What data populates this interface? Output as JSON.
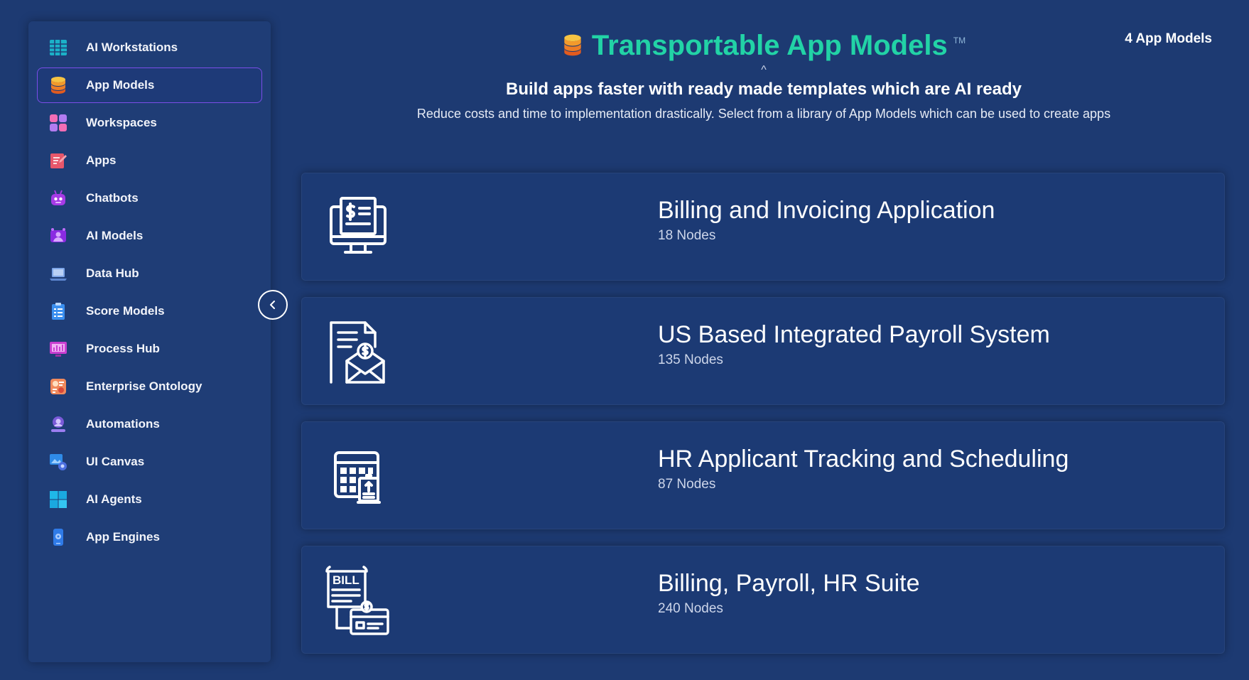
{
  "sidebar": {
    "items": [
      {
        "label": "AI Workstations",
        "icon": "table-grid-icon"
      },
      {
        "label": "App Models",
        "icon": "database-stack-icon",
        "active": true
      },
      {
        "label": "Workspaces",
        "icon": "four-squares-icon"
      },
      {
        "label": "Apps",
        "icon": "notepad-edit-icon"
      },
      {
        "label": "Chatbots",
        "icon": "robot-icon"
      },
      {
        "label": "AI Models",
        "icon": "ai-model-icon"
      },
      {
        "label": "Data Hub",
        "icon": "laptop-icon"
      },
      {
        "label": "Score Models",
        "icon": "clipboard-list-icon"
      },
      {
        "label": "Process Hub",
        "icon": "monitor-chart-icon"
      },
      {
        "label": "Enterprise Ontology",
        "icon": "ontology-icon"
      },
      {
        "label": "Automations",
        "icon": "automation-user-icon"
      },
      {
        "label": "UI Canvas",
        "icon": "canvas-gear-icon"
      },
      {
        "label": "AI Agents",
        "icon": "windows-grid-icon"
      },
      {
        "label": "App Engines",
        "icon": "engine-device-icon"
      }
    ],
    "collapse_icon": "chevron-left-icon"
  },
  "header": {
    "title_icon": "database-stack-icon",
    "title": "Transportable App Models",
    "trademark": "TM",
    "caret": "^",
    "subtitle": "Build apps faster with ready made templates which are AI ready",
    "description": "Reduce costs and time to implementation drastically. Select from a library of App Models which can be used to create apps",
    "count": "4 App Models"
  },
  "cards": [
    {
      "title": "Billing and Invoicing Application",
      "nodes": "18 Nodes",
      "icon": "billing-monitor-icon"
    },
    {
      "title": "US Based Integrated Payroll System",
      "nodes": "135 Nodes",
      "icon": "payroll-envelope-icon"
    },
    {
      "title": "HR Applicant Tracking and Scheduling",
      "nodes": "87 Nodes",
      "icon": "calendar-clipboard-icon"
    },
    {
      "title": "Billing, Payroll, HR Suite",
      "nodes": "240 Nodes",
      "icon": "bill-suite-icon"
    }
  ],
  "colors": {
    "background": "#1d3a72",
    "title": "#22d3a6",
    "active_border": "#7b4de8"
  }
}
